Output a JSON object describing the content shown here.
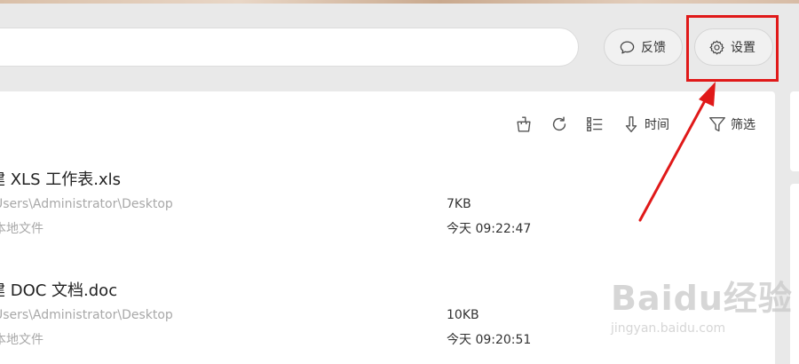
{
  "header": {
    "search_value": "",
    "feedback_label": "反馈",
    "settings_label": "设置"
  },
  "toolbar": {
    "sort_label": "时间",
    "filter_label": "筛选"
  },
  "files": [
    {
      "name": "建 XLS 工作表.xls",
      "path": "Users\\Administrator\\Desktop",
      "source": "本地文件",
      "size": "7KB",
      "time": "今天 09:22:47"
    },
    {
      "name": "建 DOC 文档.doc",
      "path": "Users\\Administrator\\Desktop",
      "source": "本地文件",
      "size": "10KB",
      "time": "今天 09:20:51"
    }
  ],
  "watermark": {
    "logo": "Baidu经验",
    "url": "jingyan.baidu.com"
  },
  "colors": {
    "highlight": "#e01919",
    "background": "#e9e9e9"
  }
}
